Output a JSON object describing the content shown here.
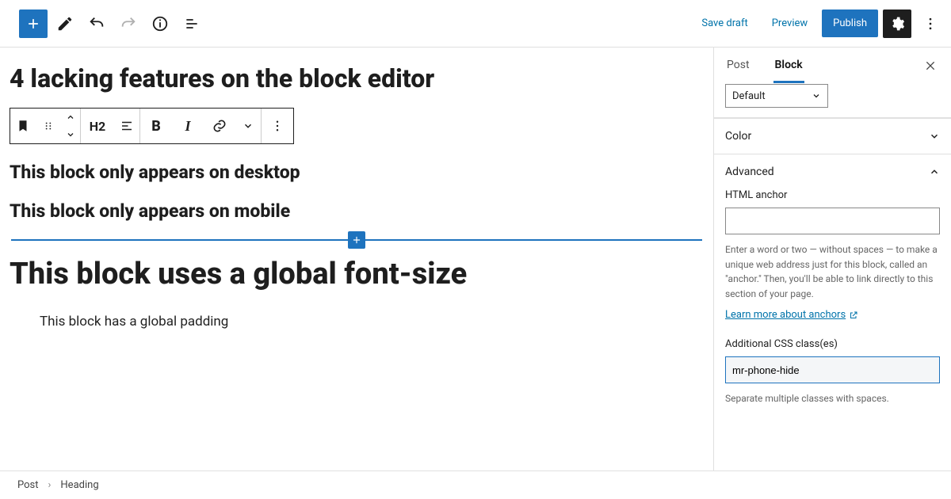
{
  "toolbar": {
    "save_draft": "Save draft",
    "preview": "Preview",
    "publish": "Publish"
  },
  "block_toolbar": {
    "heading_level": "H2"
  },
  "content": {
    "title": "4 lacking features on the block editor",
    "h2_desktop": "This block only appears on desktop",
    "h2_mobile": "This block only appears on mobile",
    "h1_fontsize": "This block uses a global font-size",
    "p_padding": "This block has a global padding"
  },
  "breadcrumb": {
    "root": "Post",
    "current": "Heading"
  },
  "sidebar": {
    "tabs": {
      "post": "Post",
      "block": "Block"
    },
    "select_value": "Default",
    "color_panel": "Color",
    "advanced_panel": "Advanced",
    "anchor": {
      "label": "HTML anchor",
      "value": "",
      "help": "Enter a word or two — without spaces — to make a unique web address just for this block, called an \"anchor.\" Then, you'll be able to link directly to this section of your page.",
      "learn": "Learn more about anchors"
    },
    "css": {
      "label": "Additional CSS class(es)",
      "value": "mr-phone-hide",
      "help": "Separate multiple classes with spaces."
    }
  }
}
